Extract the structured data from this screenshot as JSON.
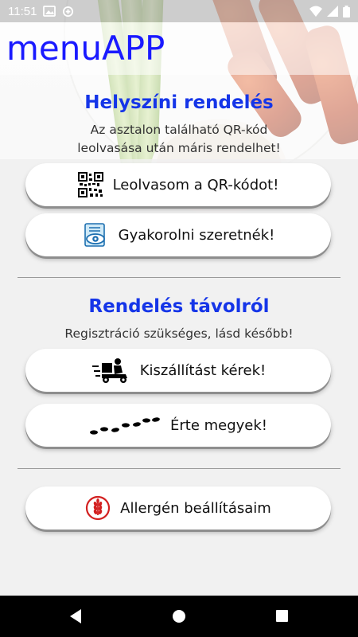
{
  "status_bar": {
    "time": "11:51",
    "left_icons": [
      "gallery-icon",
      "data-saver-icon"
    ],
    "right_icons": [
      "wifi-icon",
      "signal-icon",
      "battery-icon"
    ]
  },
  "app_bar": {
    "title": "menuAPP",
    "title_color": "#1a1aff"
  },
  "onsite": {
    "title": "Helyszíni rendelés",
    "subtitle_line1": "Az asztalon található QR-kód",
    "subtitle_line2": "leolvasása után máris rendelhet!",
    "scan_button": {
      "label": "Leolvasom a QR-kódot!",
      "icon": "qr-code-icon"
    },
    "practice_button": {
      "label": "Gyakorolni szeretnék!",
      "icon": "eye-document-icon"
    }
  },
  "remote": {
    "title": "Rendelés távolról",
    "subtitle": "Regisztráció szükséges, lásd később!",
    "delivery_button": {
      "label": "Kiszállítást kérek!",
      "icon": "delivery-scooter-icon"
    },
    "pickup_button": {
      "label": "Érte megyek!",
      "icon": "footprints-icon"
    }
  },
  "allergen_button": {
    "label": "Allergén beállításaim",
    "icon": "no-gluten-icon"
  },
  "colors": {
    "section_title": "#1535e8",
    "accent_red": "#d32020"
  },
  "nav_bar": {
    "buttons": [
      "back",
      "home",
      "recents"
    ]
  }
}
